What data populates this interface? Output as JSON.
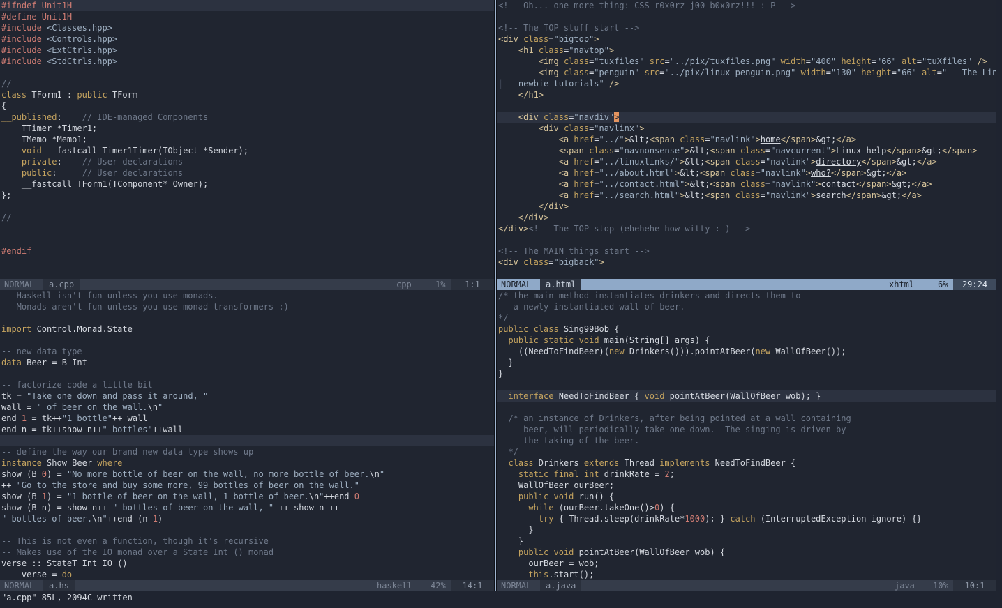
{
  "panes": {
    "cpp": {
      "status": {
        "mode": "NORMAL",
        "file": "a.cpp",
        "filetype": "cpp",
        "percent": "1%",
        "position": "1:1"
      },
      "lines": [
        "<span class=\"p\">#ifndef Unit1H</span>",
        "<span class=\"p\">#define Unit1H</span>",
        "<span class=\"p\">#include </span><span class=\"s\">&lt;Classes.hpp&gt;</span>",
        "<span class=\"p\">#include </span><span class=\"s\">&lt;Controls.hpp&gt;</span>",
        "<span class=\"p\">#include </span><span class=\"s\">&lt;ExtCtrls.hpp&gt;</span>",
        "<span class=\"p\">#include </span><span class=\"s\">&lt;StdCtrls.hpp&gt;</span>",
        "",
        "<span class=\"c\">//---------------------------------------------------------------------------</span>",
        "<span class=\"k\">class</span> TForm1 : <span class=\"k\">public</span> TForm",
        "{",
        "<span class=\"k\">__published</span>:    <span class=\"c\">// IDE-managed Components</span>",
        "    TTimer *Timer1;",
        "    TMemo *Memo1;",
        "    <span class=\"k\">void</span> __fastcall Timer1Timer(TObject *Sender);",
        "    <span class=\"k\">private</span>:    <span class=\"c\">// User declarations</span>",
        "    <span class=\"k\">public</span>:     <span class=\"c\">// User declarations</span>",
        "    __fastcall TForm1(TComponent* Owner);",
        "};",
        "",
        "<span class=\"c\">//---------------------------------------------------------------------------</span>",
        "",
        "",
        "<span class=\"p\">#endif</span>",
        "",
        "",
        "<span class=\"c\">//---------------------------------------------------------------------------</span>"
      ],
      "cursor_line": 0
    },
    "html": {
      "status": {
        "mode": "NORMAL",
        "file": "a.html",
        "filetype": "xhtml",
        "percent": "6%",
        "position": "29:24"
      },
      "lines": [
        "<span class=\"c\">&lt;!-- Oh... one more thing: CSS r0x0rz j00 b0x0rz!!! :-P --&gt;</span>",
        "",
        "<span class=\"c\">&lt;!-- The TOP stuff start --&gt;</span>",
        "<span class=\"tag\">&lt;div</span> <span class=\"at\">class</span>=<span class=\"s\">\"bigtop\"</span><span class=\"tag\">&gt;</span>",
        "    <span class=\"tag\">&lt;h1</span> <span class=\"at\">class</span>=<span class=\"s\">\"navtop\"</span><span class=\"tag\">&gt;</span>",
        "        <span class=\"tag\">&lt;img</span> <span class=\"at\">class</span>=<span class=\"s\">\"tuxfiles\"</span> <span class=\"at\">src</span>=<span class=\"s\">\"../pix/tuxfiles.png\"</span> <span class=\"at\">width</span>=<span class=\"s\">\"400\"</span> <span class=\"at\">height</span>=<span class=\"s\">\"66\"</span> <span class=\"at\">alt</span>=<span class=\"s\">\"tuXfiles\"</span> <span class=\"tag\">/&gt;</span>",
        "        <span class=\"tag\">&lt;img</span> <span class=\"at\">class</span>=<span class=\"s\">\"penguin\"</span> <span class=\"at\">src</span>=<span class=\"s\">\"../pix/linux-penguin.png\"</span> <span class=\"at\">width</span>=<span class=\"s\">\"130\"</span> <span class=\"at\">height</span>=<span class=\"s\">\"66\"</span> <span class=\"at\">alt</span>=<span class=\"s\">\"-- The Linux</span>",
        "<span class=\"ws\">|</span>   <span class=\"s\">newbie tutorials\"</span> <span class=\"tag\">/&gt;</span>",
        "    <span class=\"tag\">&lt;/h1&gt;</span>",
        "",
        "    <span class=\"tag\">&lt;div</span> <span class=\"at\">class</span>=<span class=\"s\">\"navdiv\"</span><span class=\"cursor\">&gt;</span>",
        "        <span class=\"tag\">&lt;div</span> <span class=\"at\">class</span>=<span class=\"s\">\"navlinx\"</span><span class=\"tag\">&gt;</span>",
        "            <span class=\"tag\">&lt;a</span> <span class=\"at\">href</span>=<span class=\"s\">\"../\"</span><span class=\"tag\">&gt;</span>&amp;lt;<span class=\"tag\">&lt;span</span> <span class=\"at\">class</span>=<span class=\"s\">\"navlink\"</span><span class=\"tag\">&gt;</span><span class=\"u\">home</span><span class=\"tag\">&lt;/span&gt;</span>&amp;gt;<span class=\"tag\">&lt;/a&gt;</span>",
        "            <span class=\"tag\">&lt;span</span> <span class=\"at\">class</span>=<span class=\"s\">\"navnonsense\"</span><span class=\"tag\">&gt;</span>&amp;lt;<span class=\"tag\">&lt;span</span> <span class=\"at\">class</span>=<span class=\"s\">\"navcurrent\"</span><span class=\"tag\">&gt;</span>Linux help<span class=\"tag\">&lt;/span&gt;</span>&amp;gt;<span class=\"tag\">&lt;/span&gt;</span>",
        "            <span class=\"tag\">&lt;a</span> <span class=\"at\">href</span>=<span class=\"s\">\"../linuxlinks/\"</span><span class=\"tag\">&gt;</span>&amp;lt;<span class=\"tag\">&lt;span</span> <span class=\"at\">class</span>=<span class=\"s\">\"navlink\"</span><span class=\"tag\">&gt;</span><span class=\"u\">directory</span><span class=\"tag\">&lt;/span&gt;</span>&amp;gt;<span class=\"tag\">&lt;/a&gt;</span>",
        "            <span class=\"tag\">&lt;a</span> <span class=\"at\">href</span>=<span class=\"s\">\"../about.html\"</span><span class=\"tag\">&gt;</span>&amp;lt;<span class=\"tag\">&lt;span</span> <span class=\"at\">class</span>=<span class=\"s\">\"navlink\"</span><span class=\"tag\">&gt;</span><span class=\"u\">who?</span><span class=\"tag\">&lt;/span&gt;</span>&amp;gt;<span class=\"tag\">&lt;/a&gt;</span>",
        "            <span class=\"tag\">&lt;a</span> <span class=\"at\">href</span>=<span class=\"s\">\"../contact.html\"</span><span class=\"tag\">&gt;</span>&amp;lt;<span class=\"tag\">&lt;span</span> <span class=\"at\">class</span>=<span class=\"s\">\"navlink\"</span><span class=\"tag\">&gt;</span><span class=\"u\">contact</span><span class=\"tag\">&lt;/span&gt;</span>&amp;gt;<span class=\"tag\">&lt;/a&gt;</span>",
        "            <span class=\"tag\">&lt;a</span> <span class=\"at\">href</span>=<span class=\"s\">\"../search.html\"</span><span class=\"tag\">&gt;</span>&amp;lt;<span class=\"tag\">&lt;span</span> <span class=\"at\">class</span>=<span class=\"s\">\"navlink\"</span><span class=\"tag\">&gt;</span><span class=\"u\">search</span><span class=\"tag\">&lt;/span&gt;</span>&amp;gt;<span class=\"tag\">&lt;/a&gt;</span>",
        "        <span class=\"tag\">&lt;/div&gt;</span>",
        "    <span class=\"tag\">&lt;/div&gt;</span>",
        "<span class=\"tag\">&lt;/div&gt;</span><span class=\"c\">&lt;!-- The TOP stop (ehehehe how witty :-) --&gt;</span>",
        "",
        "<span class=\"c\">&lt;!-- The MAIN things start --&gt;</span>",
        "<span class=\"tag\">&lt;div</span> <span class=\"at\">class</span>=<span class=\"s\">\"bigback\"</span><span class=\"tag\">&gt;</span>"
      ],
      "cursor_line": 10
    },
    "hs": {
      "status": {
        "mode": "NORMAL",
        "file": "a.hs",
        "filetype": "haskell",
        "percent": "42%",
        "position": "14:1"
      },
      "lines": [
        "<span class=\"c\">-- Haskell isn't fun unless you use monads.</span>",
        "<span class=\"c\">-- Monads aren't fun unless you use monad transformers :)</span>",
        "",
        "<span class=\"k\">import</span> Control.Monad.State",
        "",
        "<span class=\"c\">-- new data type</span>",
        "<span class=\"k\">data</span> Beer = B Int",
        "",
        "<span class=\"c\">-- factorize code a little bit</span>",
        "tk = <span class=\"s\">\"Take one down and pass it around, \"</span>",
        "wall = <span class=\"s\">\" of beer on the wall.</span>\\n<span class=\"s\">\"</span>",
        "end <span class=\"n\">1</span> = tk++<span class=\"s\">\"1 bottle\"</span>++ wall",
        "end n = tk++show n++<span class=\"s\">\" bottles\"</span>++wall",
        "",
        "<span class=\"c\">-- define the way our brand new data type shows up</span>",
        "<span class=\"k\">instance</span> Show Beer <span class=\"k\">where</span>",
        "show (B <span class=\"n\">0</span>) = <span class=\"s\">\"No more bottle of beer on the wall, no more bottle of beer.</span>\\n<span class=\"s\">\"</span>",
        "++ <span class=\"s\">\"Go to the store and buy some more, 99 bottles of beer on the wall.\"</span>",
        "show (B <span class=\"n\">1</span>) = <span class=\"s\">\"1 bottle of beer on the wall, 1 bottle of beer.</span>\\n<span class=\"s\">\"</span>++end <span class=\"n\">0</span>",
        "show (B n) = show n++ <span class=\"s\">\" bottles of beer on the wall, \"</span> ++ show n ++",
        "<span class=\"s\">\" bottles of beer.</span>\\n<span class=\"s\">\"</span>++end (n-<span class=\"n\">1</span>)",
        "",
        "<span class=\"c\">-- This is not even a function, though it's recursive</span>",
        "<span class=\"c\">-- Makes use of the IO monad over a State Int () monad</span>",
        "verse :: StateT Int IO ()",
        "    verse = <span class=\"k\">do</span>"
      ],
      "cursor_line": 13
    },
    "java": {
      "status": {
        "mode": "NORMAL",
        "file": "a.java",
        "filetype": "java",
        "percent": "10%",
        "position": "10:1"
      },
      "lines": [
        "<span class=\"c\">/* the main method instantiates drinkers and directs them to</span>",
        "<span class=\"c\">   a newly-instantiated wall of beer.</span>",
        "<span class=\"c\">*/</span>",
        "<span class=\"k\">public</span> <span class=\"k\">class</span> Sing99Bob {",
        "  <span class=\"k\">public</span> <span class=\"k\">static</span> <span class=\"k\">void</span> main(String[] args) {",
        "    ((NeedToFindBeer)(<span class=\"k\">new</span> Drinkers())).pointAtBeer(<span class=\"k\">new</span> WallOfBeer());",
        "  }",
        "}",
        "",
        "  <span class=\"k\">interface</span> NeedToFindBeer { <span class=\"k\">void</span> pointAtBeer(WallOfBeer wob); }",
        "",
        "  <span class=\"c\">/* an instance of Drinkers, after being pointed at a wall containing</span>",
        "<span class=\"c\">     beer, will periodically take one down.  The singing is driven by</span>",
        "<span class=\"c\">     the taking of the beer.</span>",
        "<span class=\"c\">  */</span>",
        "  <span class=\"k\">class</span> Drinkers <span class=\"k\">extends</span> Thread <span class=\"k\">implements</span> NeedToFindBeer {",
        "    <span class=\"k\">static</span> <span class=\"k\">final</span> <span class=\"k\">int</span> drinkRate = <span class=\"n\">2</span>;",
        "    WallOfBeer ourBeer;",
        "    <span class=\"k\">public</span> <span class=\"k\">void</span> run() {",
        "      <span class=\"k\">while</span> (ourBeer.takeOne()&gt;<span class=\"n\">0</span>) {",
        "        <span class=\"k\">try</span> { Thread.sleep(drinkRate*<span class=\"n\">1000</span>); } <span class=\"k\">catch</span> (InterruptedException ignore) {}",
        "      }",
        "    }",
        "    <span class=\"k\">public</span> <span class=\"k\">void</span> pointAtBeer(WallOfBeer wob) {",
        "      ourBeer = wob;",
        "      <span class=\"k\">this</span>.start();"
      ],
      "cursor_line": 9
    }
  },
  "cmdline": "\"a.cpp\" 85L, 2094C written"
}
